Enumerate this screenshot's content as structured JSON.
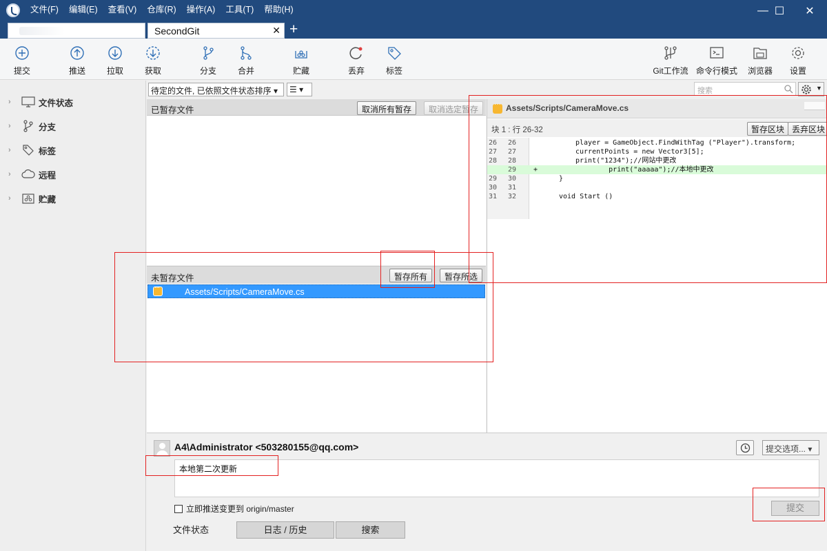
{
  "menu": [
    "文件(F)",
    "编辑(E)",
    "查看(V)",
    "仓库(R)",
    "操作(A)",
    "工具(T)",
    "帮助(H)"
  ],
  "window_controls": {
    "minimize": "—",
    "maximize": "☐",
    "close": "✕"
  },
  "tabs": [
    {
      "label": "",
      "blurred": true
    },
    {
      "label": "SecondGit",
      "close": "✕"
    }
  ],
  "tab_add": "+",
  "toolbar": {
    "left": [
      "提交",
      "推送",
      "拉取",
      "获取",
      "分支",
      "合并",
      "贮藏",
      "丢弃",
      "标签"
    ],
    "right": [
      "Git工作流",
      "命令行模式",
      "浏览器",
      "设置"
    ]
  },
  "sidebar": {
    "items": [
      {
        "label": "文件状态",
        "icon": "monitor-icon"
      },
      {
        "label": "分支",
        "icon": "branch-icon"
      },
      {
        "label": "标签",
        "icon": "tag-icon"
      },
      {
        "label": "远程",
        "icon": "cloud-icon"
      },
      {
        "label": "贮藏",
        "icon": "stash-icon"
      }
    ]
  },
  "filter": {
    "sort_dropdown": "待定的文件, 已依照文件状态排序 ▾",
    "view_dropdown": "☰ ▾",
    "search_placeholder": "搜索"
  },
  "staged": {
    "title": "已暂存文件",
    "unstage_all": "取消所有暂存",
    "unstage_selected": "取消选定暂存"
  },
  "unstaged": {
    "title": "未暂存文件",
    "stage_all": "暂存所有",
    "stage_selected": "暂存所选",
    "files": [
      "Assets/Scripts/CameraMove.cs"
    ]
  },
  "diff": {
    "file_path": "Assets/Scripts/CameraMove.cs",
    "hunk_label": "块 1 : 行 26-32",
    "stage_hunk": "暂存区块",
    "discard_hunk": "丢弃区块",
    "lines": [
      {
        "old": "26",
        "new": "26",
        "marker": "",
        "text": "player = GameObject.FindWithTag (\"Player\").transform;",
        "added": false
      },
      {
        "old": "27",
        "new": "27",
        "marker": "",
        "text": "currentPoints = new Vector3[5];",
        "added": false
      },
      {
        "old": "28",
        "new": "28",
        "marker": "",
        "text": "print(\"1234\");//网站中更改",
        "added": false
      },
      {
        "old": "",
        "new": "29",
        "marker": "+",
        "text": "        print(\"aaaaa\");//本地中更改",
        "added": true
      },
      {
        "old": "29",
        "new": "30",
        "marker": "",
        "text": "}",
        "added": false
      },
      {
        "old": "30",
        "new": "31",
        "marker": "",
        "text": "",
        "added": false
      },
      {
        "old": "31",
        "new": "32",
        "marker": "",
        "text": "void Start ()",
        "added": false
      }
    ]
  },
  "commit": {
    "author": "A4\\Administrator <503280155@qq.com>",
    "options_dropdown": "提交选项... ▾",
    "message": "本地第二次更新",
    "push_checkbox": "立即推送变更到 origin/master",
    "push_checked": false,
    "commit_button": "提交"
  },
  "bottom_tabs": [
    "文件状态",
    "日志 / 历史",
    "搜索"
  ],
  "colors": {
    "title_bar": "#214a7e",
    "selection": "#3399ff",
    "added_line": "#d9fbd9",
    "file_modified": "#f7b731",
    "annotation_red": "#e32020",
    "icon_blue": "#2f6fb6"
  }
}
